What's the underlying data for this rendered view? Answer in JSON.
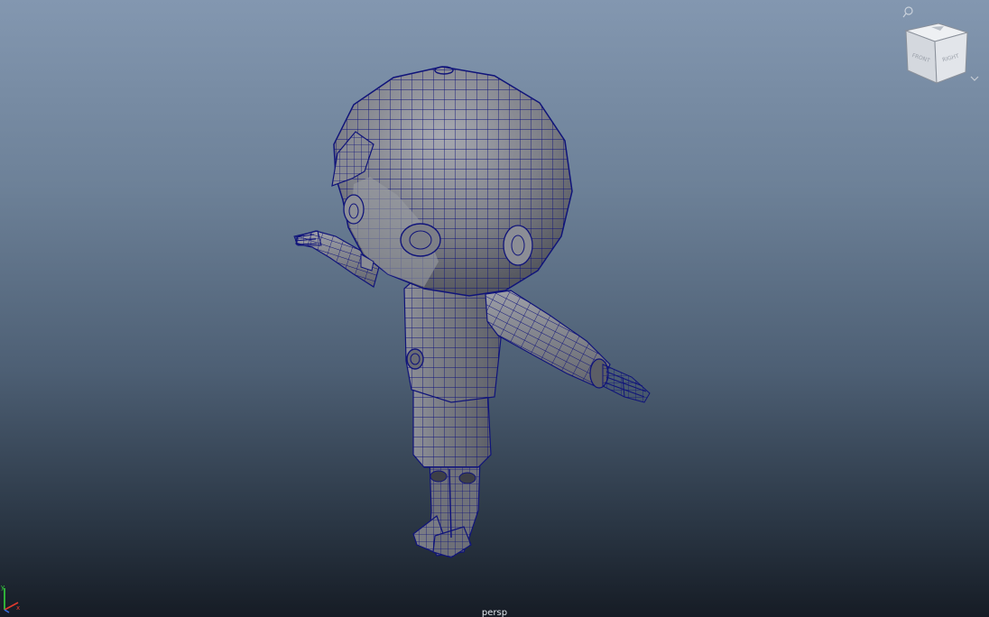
{
  "viewport": {
    "camera_label": "persp"
  },
  "view_cube": {
    "face_front": "FRONT",
    "face_right": "RIGHT"
  },
  "axis_indicator": {
    "y_label": "y",
    "x_label": "x"
  },
  "colors": {
    "wireframe": "#10147a",
    "mesh_fill": "#7c7e86",
    "mesh_fill_light": "#a3a5ad",
    "mesh_fill_dark": "#5a5c64"
  }
}
